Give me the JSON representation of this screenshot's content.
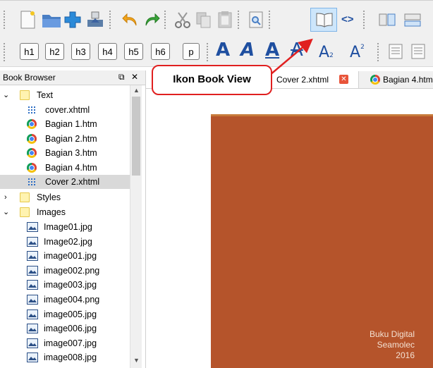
{
  "panel": {
    "title": "Book Browser",
    "float_glyph": "⧉",
    "close_glyph": "✕"
  },
  "heading_buttons": [
    "h1",
    "h2",
    "h3",
    "h4",
    "h5",
    "h6",
    "p"
  ],
  "code_view_glyph": "<>",
  "callout": {
    "label": "Ikon Book View"
  },
  "tabs": [
    {
      "label": "Cover 2.xhtml",
      "close_glyph": "✕"
    },
    {
      "label": "Bagian 4.htm"
    }
  ],
  "tree": {
    "folders": {
      "text": "Text",
      "styles": "Styles",
      "images": "Images"
    },
    "text_files": [
      {
        "label": "cover.xhtml",
        "type": "xhtml-icon"
      },
      {
        "label": "Bagian 1.htm",
        "type": "chrome-icon"
      },
      {
        "label": "Bagian 2.htm",
        "type": "chrome-icon"
      },
      {
        "label": "Bagian 3.htm",
        "type": "chrome-icon"
      },
      {
        "label": "Bagian 4.htm",
        "type": "chrome-icon"
      },
      {
        "label": "Cover 2.xhtml",
        "type": "xhtml-icon",
        "selected": true
      }
    ],
    "image_files": [
      "Image01.jpg",
      "Image02.jpg",
      "image001.jpg",
      "image002.png",
      "image003.jpg",
      "image004.png",
      "image005.jpg",
      "image006.jpg",
      "image007.jpg",
      "image008.jpg"
    ]
  },
  "cover_text": {
    "line1": "Buku Digital",
    "line2": "Seamolec",
    "line3": "2016"
  },
  "colors": {
    "accent_red": "#e02020",
    "cover": "#b5542b",
    "letter_blue": "#1f4fa0"
  }
}
